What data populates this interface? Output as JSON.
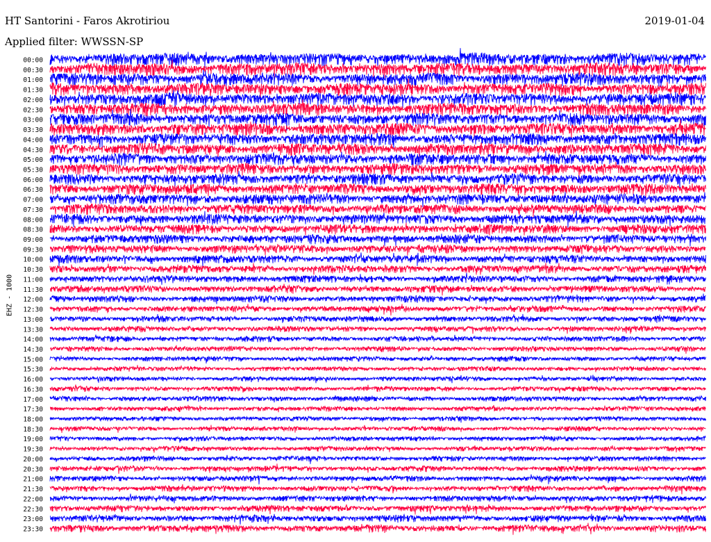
{
  "header": {
    "station": "HT Santorini - Faros Akrotiriou",
    "date": "2019-01-04",
    "filter_label": "Applied filter: WWSSN-SP"
  },
  "chart_data": {
    "type": "helicorder",
    "ylabel": "EHZ - 1000",
    "trace_colors": [
      "#0000ff",
      "#ff0040"
    ],
    "row_labels": [
      "00:00",
      "00:30",
      "01:00",
      "01:30",
      "02:00",
      "02:30",
      "03:00",
      "03:30",
      "04:00",
      "04:30",
      "05:00",
      "05:30",
      "06:00",
      "06:30",
      "07:00",
      "07:30",
      "08:00",
      "08:30",
      "09:00",
      "09:30",
      "10:00",
      "10:30",
      "11:00",
      "11:30",
      "12:00",
      "12:30",
      "13:00",
      "13:30",
      "14:00",
      "14:30",
      "15:00",
      "15:30",
      "16:00",
      "16:30",
      "17:00",
      "17:30",
      "18:00",
      "18:30",
      "19:00",
      "19:30",
      "20:00",
      "20:30",
      "21:00",
      "21:30",
      "22:00",
      "22:30",
      "23:00",
      "23:30"
    ],
    "minutes_per_line": 30,
    "relative_amplitude": [
      1.35,
      1.35,
      1.32,
      1.3,
      1.28,
      1.28,
      1.25,
      1.25,
      1.22,
      1.2,
      1.18,
      1.15,
      1.12,
      1.1,
      1.08,
      1.05,
      1.02,
      0.98,
      0.92,
      0.88,
      0.84,
      0.8,
      0.76,
      0.72,
      0.7,
      0.66,
      0.62,
      0.6,
      0.58,
      0.55,
      0.52,
      0.5,
      0.5,
      0.52,
      0.55,
      0.52,
      0.5,
      0.5,
      0.5,
      0.52,
      0.55,
      0.58,
      0.6,
      0.62,
      0.65,
      0.68,
      0.72,
      0.75
    ]
  }
}
